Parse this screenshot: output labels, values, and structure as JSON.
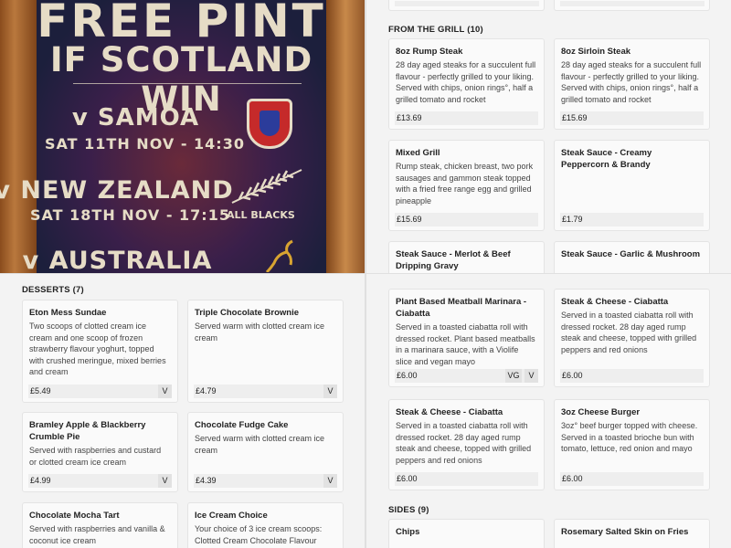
{
  "poster": {
    "headline_1": "FREE PINT",
    "headline_2": "IF SCOTLAND WIN",
    "match_1_team": "v SAMOA",
    "match_1_date": "SAT 11TH NOV - 14:30",
    "match_2_team": "v NEW ZEALAND",
    "match_2_date": "SAT 18TH NOV - 17:15",
    "match_2_badge": "ALL BLACKS",
    "match_3_team": "v AUSTRALIA"
  },
  "desserts": {
    "title": "DESSERTS (7)",
    "items": [
      {
        "name": "Eton Mess Sundae",
        "desc": "Two scoops of clotted cream ice cream and one scoop of frozen strawberry flavour yoghurt, topped with crushed meringue, mixed berries and cream",
        "price": "£5.49",
        "tags": [
          "V"
        ]
      },
      {
        "name": "Triple Chocolate Brownie",
        "desc": "Served warm with clotted cream ice cream",
        "price": "£4.79",
        "tags": [
          "V"
        ]
      },
      {
        "name": "Bramley Apple & Blackberry Crumble Pie",
        "desc": "Served with raspberries and custard or clotted cream ice cream",
        "price": "£4.99",
        "tags": [
          "V"
        ]
      },
      {
        "name": "Chocolate Fudge Cake",
        "desc": "Served warm with clotted cream ice cream",
        "price": "£4.39",
        "tags": [
          "V"
        ]
      },
      {
        "name": "Chocolate Mocha Tart",
        "desc": "Served with raspberries and vanilla & coconut ice cream",
        "price": "",
        "tags": []
      },
      {
        "name": "Ice Cream Choice",
        "desc": "Your choice of 3 ice cream scoops: Clotted Cream Chocolate Flavour",
        "price": "",
        "tags": []
      }
    ]
  },
  "grill": {
    "top_price": "£...",
    "title": "FROM THE GRILL (10)",
    "items": [
      {
        "name": "8oz Rump Steak",
        "desc": "28 day aged steaks for a succulent full flavour - perfectly grilled to your liking. Served with chips, onion rings°, half a grilled tomato and rocket",
        "price": "£13.69"
      },
      {
        "name": "8oz Sirloin Steak",
        "desc": "28 day aged steaks for a succulent full flavour - perfectly grilled to your liking. Served with chips, onion rings°, half a grilled tomato and rocket",
        "price": "£15.69"
      },
      {
        "name": "Mixed Grill",
        "desc": "Rump steak, chicken breast, two pork sausages and gammon steak topped with a fried free range egg and grilled pineapple",
        "price": "£15.69"
      },
      {
        "name": "Steak Sauce - Creamy Peppercorn & Brandy",
        "desc": "",
        "price": "£1.79"
      },
      {
        "name": "Steak Sauce - Merlot & Beef Dripping Gravy",
        "desc": "",
        "price": ""
      },
      {
        "name": "Steak Sauce - Garlic & Mushroom",
        "desc": "",
        "price": ""
      }
    ]
  },
  "mains": {
    "items": [
      {
        "name": "Plant Based Meatball Marinara - Ciabatta",
        "desc": "Served in a toasted ciabatta roll with dressed rocket. Plant based meatballs in a marinara sauce, with a Violife slice and vegan mayo",
        "price": "£6.00",
        "tags": [
          "VG",
          "V"
        ]
      },
      {
        "name": "Steak & Cheese - Ciabatta",
        "desc": "Served in a toasted ciabatta roll with dressed rocket. 28 day aged rump steak and cheese, topped with grilled peppers and red onions",
        "price": "£6.00",
        "tags": []
      },
      {
        "name": "Steak & Cheese - Ciabatta",
        "desc": "Served in a toasted ciabatta roll with dressed rocket. 28 day aged rump steak and cheese, topped with grilled peppers and red onions",
        "price": "£6.00",
        "tags": []
      },
      {
        "name": "3oz Cheese Burger",
        "desc": "3oz° beef burger topped with cheese. Served in a toasted brioche bun with tomato, lettuce, red onion and mayo",
        "price": "£6.00",
        "tags": []
      }
    ]
  },
  "sides": {
    "title": "SIDES (9)",
    "items": [
      {
        "name": "Chips"
      },
      {
        "name": "Rosemary Salted Skin on Fries"
      }
    ]
  }
}
